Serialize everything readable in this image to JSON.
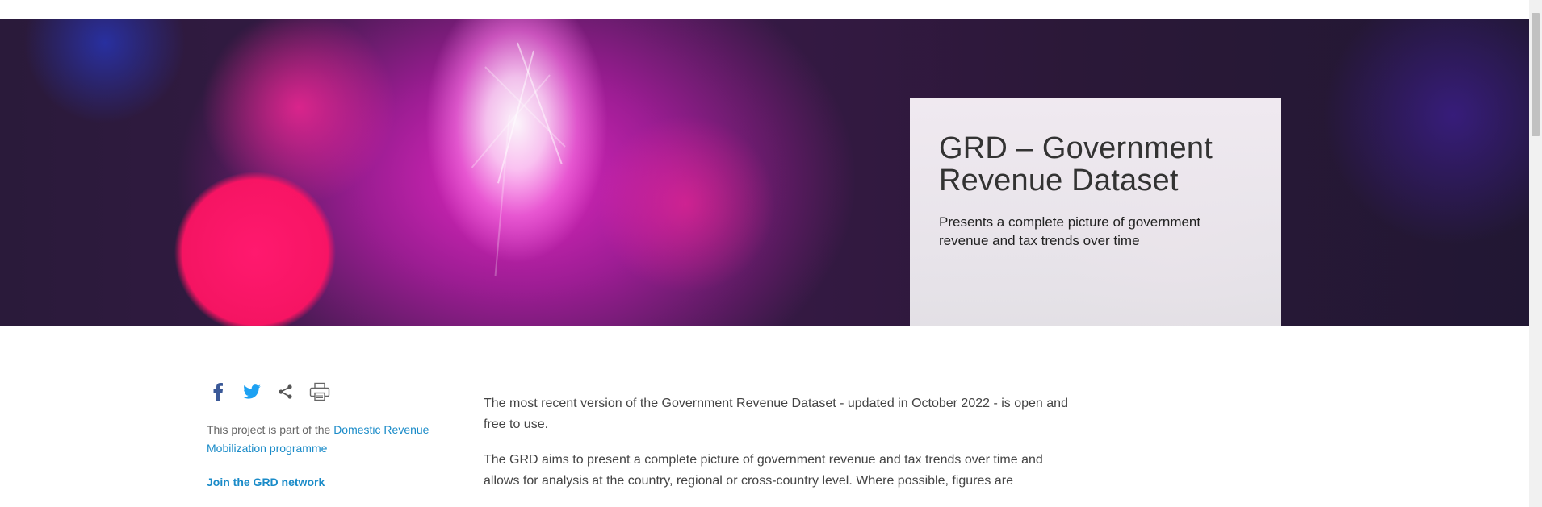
{
  "hero": {
    "title": "GRD – Government Revenue Dataset",
    "subtitle": "Presents a complete picture of government revenue and tax trends over time"
  },
  "share": {
    "icons": [
      "facebook-icon",
      "twitter-icon",
      "share-icon",
      "print-icon"
    ],
    "facebook_color": "#3b5998",
    "twitter_color": "#1da1f2"
  },
  "sidebar": {
    "note_prefix": "This project is part of the ",
    "note_link": "Domestic Revenue Mobilization programme",
    "join_link": "Join the GRD network"
  },
  "content": {
    "paragraph_1": "The most recent version of the Government Revenue Dataset - updated in October 2022 - is open and free to use.",
    "paragraph_2": "The GRD aims to present a complete picture of government revenue and tax trends over time and allows for analysis at the country, regional or cross-country level. Where possible, figures are"
  },
  "colors": {
    "link": "#1a8bc8",
    "hero_card": "#efeaf0"
  }
}
